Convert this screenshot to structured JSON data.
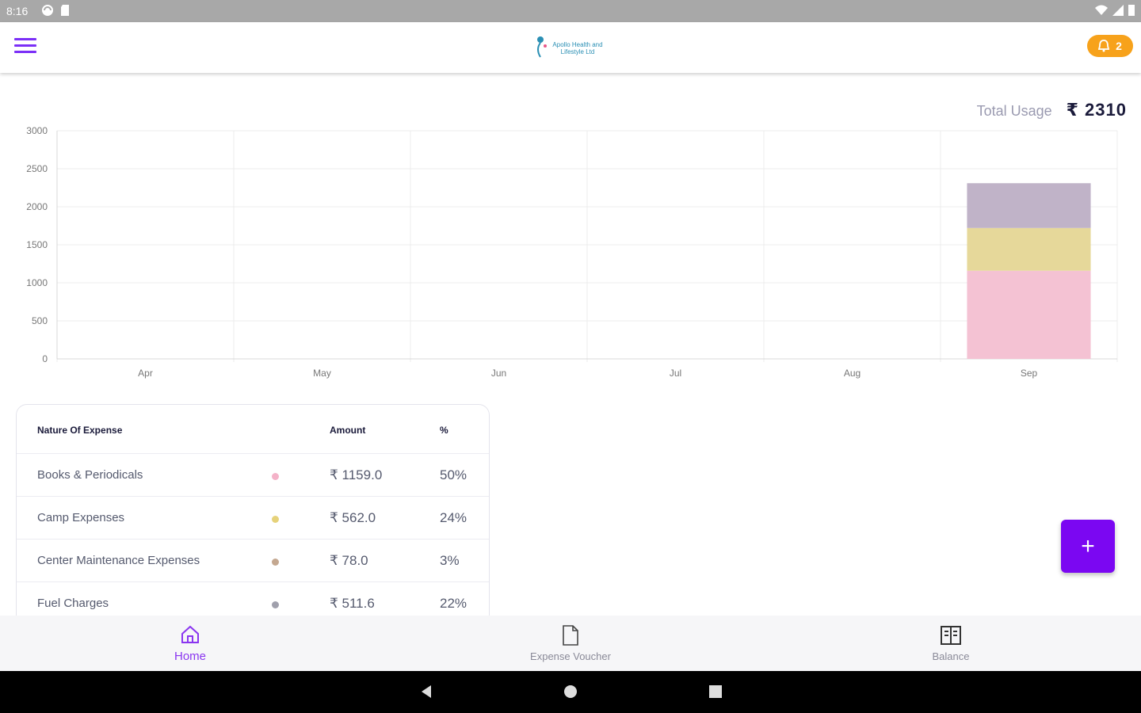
{
  "status_bar": {
    "time": "8:16"
  },
  "app_bar": {
    "logo_text": "Apollo Health and Lifestyle Ltd",
    "notification_count": "2",
    "colors": {
      "accent": "#7b2ff7",
      "badge": "#f7a21b"
    }
  },
  "summary": {
    "total_usage_label": "Total Usage",
    "total_usage_value": "₹ 2310"
  },
  "chart_data": {
    "type": "bar",
    "stacked": true,
    "categories": [
      "Apr",
      "May",
      "Jun",
      "Jul",
      "Aug",
      "Sep"
    ],
    "series": [
      {
        "values": [
          0,
          0,
          0,
          0,
          0,
          1159
        ],
        "color": "#f4c2d3"
      },
      {
        "values": [
          0,
          0,
          0,
          0,
          0,
          562
        ],
        "color": "#e6d89a"
      },
      {
        "values": [
          0,
          0,
          0,
          0,
          0,
          589
        ],
        "color": "#c0b3c8"
      }
    ],
    "ylim": [
      0,
      3000
    ],
    "yticks": [
      0,
      500,
      1000,
      1500,
      2000,
      2500,
      3000
    ],
    "grid": true
  },
  "expense_table": {
    "headers": {
      "nature": "Nature Of Expense",
      "amount": "Amount",
      "percent": "%"
    },
    "rows": [
      {
        "name": "Books & Periodicals",
        "amount": "₹ 1159.0",
        "percent": "50%",
        "dot_color": "#f4b2c8"
      },
      {
        "name": "Camp Expenses",
        "amount": "₹ 562.0",
        "percent": "24%",
        "dot_color": "#e6d27a"
      },
      {
        "name": "Center Maintenance Expenses",
        "amount": "₹ 78.0",
        "percent": "3%",
        "dot_color": "#c4a890"
      },
      {
        "name": "Fuel Charges",
        "amount": "₹ 511.6",
        "percent": "22%",
        "dot_color": "#a0a0ac"
      }
    ]
  },
  "fab": {
    "label": "+"
  },
  "bottom_nav": {
    "items": [
      {
        "label": "Home",
        "icon": "home-icon",
        "active": true
      },
      {
        "label": "Expense Voucher",
        "icon": "document-icon",
        "active": false
      },
      {
        "label": "Balance",
        "icon": "ledger-icon",
        "active": false
      }
    ]
  }
}
